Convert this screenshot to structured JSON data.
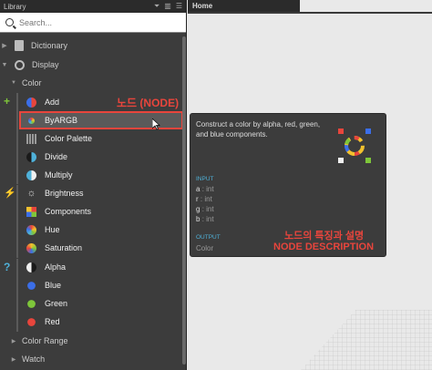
{
  "library": {
    "title": "Library",
    "search_placeholder": "Search...",
    "categories": [
      {
        "label": "Dictionary"
      },
      {
        "label": "Display"
      }
    ],
    "subcategory_color": "Color",
    "items": [
      {
        "label": "Add",
        "icon": "add-color-icon"
      },
      {
        "label": "ByARGB",
        "icon": "byargb-icon"
      },
      {
        "label": "Color Palette",
        "icon": "color-palette-icon"
      },
      {
        "label": "Divide",
        "icon": "divide-color-icon"
      },
      {
        "label": "Multiply",
        "icon": "multiply-color-icon"
      },
      {
        "label": "Brightness",
        "icon": "brightness-icon"
      },
      {
        "label": "Components",
        "icon": "components-icon"
      },
      {
        "label": "Hue",
        "icon": "hue-icon"
      },
      {
        "label": "Saturation",
        "icon": "saturation-icon"
      },
      {
        "label": "Alpha",
        "icon": "alpha-icon"
      },
      {
        "label": "Blue",
        "icon": "blue-icon"
      },
      {
        "label": "Green",
        "icon": "green-icon"
      },
      {
        "label": "Red",
        "icon": "red-icon"
      }
    ],
    "collapsed": [
      {
        "label": "Color Range"
      },
      {
        "label": "Watch"
      }
    ]
  },
  "annotations": {
    "node": "노드 (NODE)",
    "desc_korean": "노드의 특징과 설명",
    "desc_english": "NODE DESCRIPTION"
  },
  "workspace": {
    "tab": "Home"
  },
  "tooltip": {
    "description": "Construct a color by alpha, red, green, and blue components.",
    "input_header": "INPUT",
    "inputs": [
      {
        "name": "a",
        "type": ": int"
      },
      {
        "name": "r",
        "type": ": int"
      },
      {
        "name": "g",
        "type": ": int"
      },
      {
        "name": "b",
        "type": ": int"
      }
    ],
    "output_header": "OUTPUT",
    "output": "Color"
  },
  "colors": {
    "highlight_border": "#e8453c",
    "accent_blue": "#4fb1d9",
    "create_mark": "#7ec63a",
    "action_mark": "#e8453c",
    "query_mark": "#4fb1d9"
  }
}
